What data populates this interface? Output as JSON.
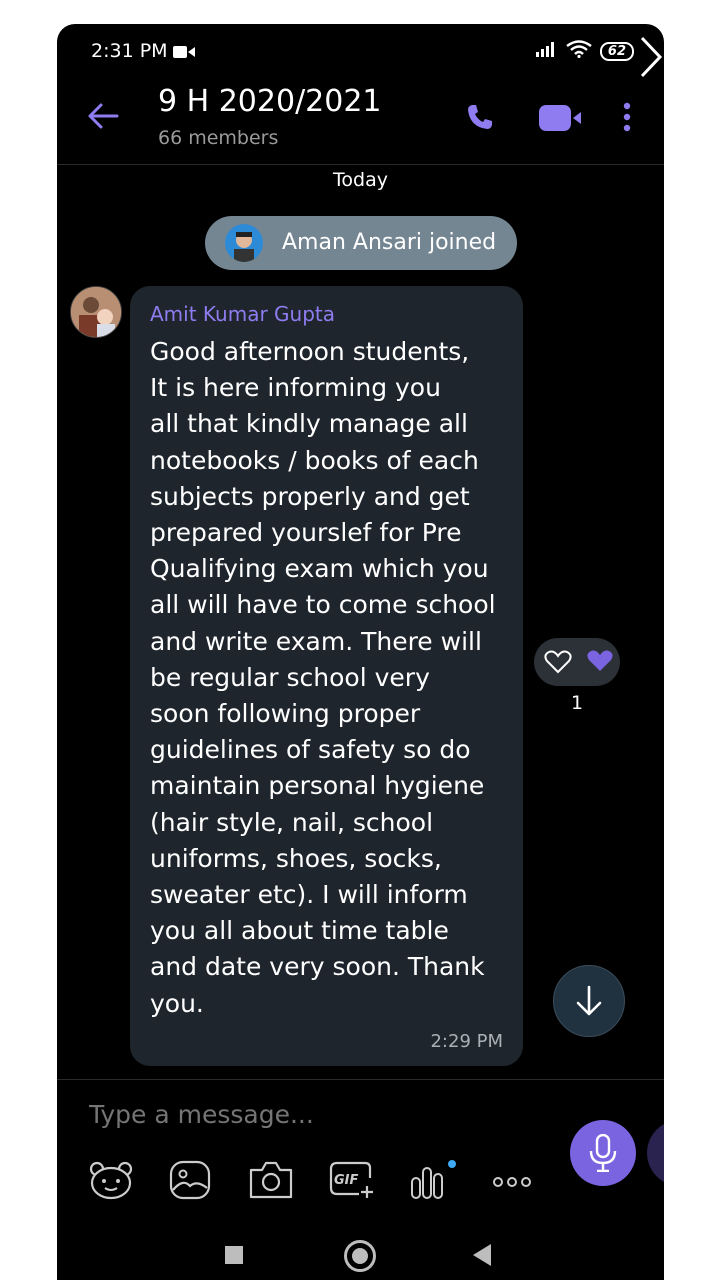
{
  "status": {
    "time": "2:31 PM",
    "battery": "62"
  },
  "header": {
    "title": "9 H 2020/2021",
    "subtitle": "66 members"
  },
  "chat": {
    "day_divider": "Today",
    "system_event": "Aman Ansari joined",
    "message": {
      "sender": "Amit Kumar Gupta",
      "text": "Good afternoon students,\nIt is here informing you\nall that kindly manage all\nnotebooks / books of each\nsubjects  properly and get\nprepared yourslef for Pre\nQualifying exam which you\nall will have to come school\nand write exam. There will\nbe  regular school very\nsoon following proper\nguidelines of safety so do\nmaintain personal hygiene\n(hair style, nail, school\nuniforms, shoes, socks,\nsweater etc). I will inform\nyou all about time table\nand date very soon.  Thank\nyou.",
      "time": "2:29 PM",
      "reaction_count": "1"
    }
  },
  "composer": {
    "placeholder": "Type a message..."
  },
  "icons": {
    "toolbar": [
      "sticker-icon",
      "gallery-icon",
      "camera-icon",
      "gif-icon",
      "poll-icon",
      "more-options-icon"
    ],
    "accent": "#7b64e0"
  }
}
